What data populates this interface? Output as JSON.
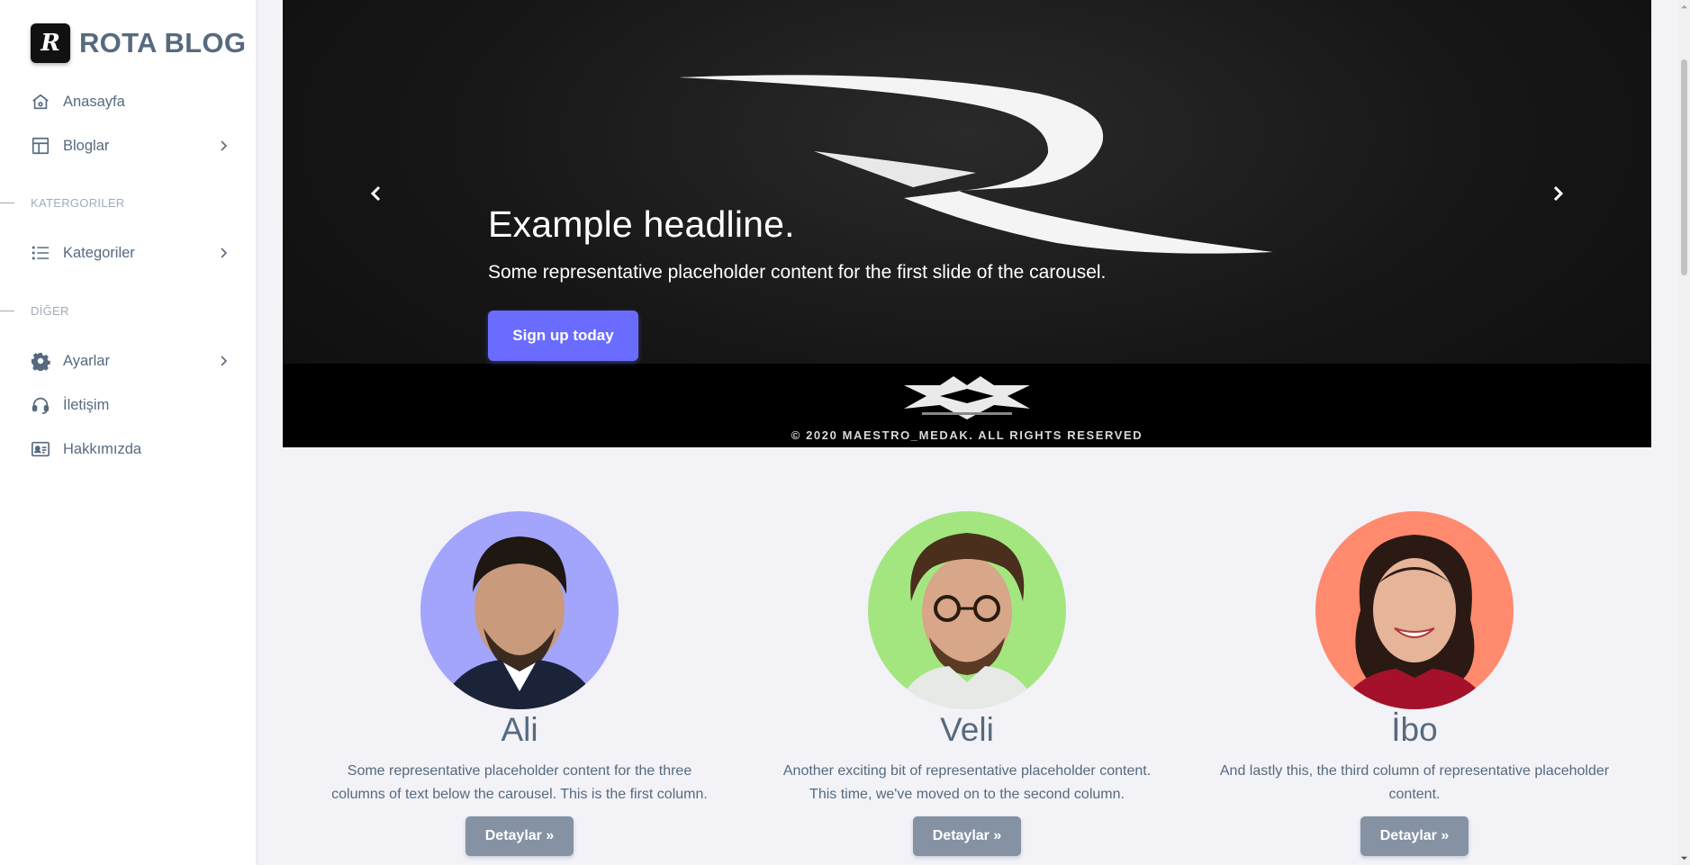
{
  "brand": {
    "name": "ROTA BLOG",
    "logo_letter": "R"
  },
  "sidebar": {
    "items": [
      {
        "label": "Anasayfa",
        "icon": "home-icon"
      },
      {
        "label": "Bloglar",
        "icon": "layout-icon",
        "has_submenu": true
      }
    ],
    "section_categories": {
      "header": "KATERGORILER",
      "items": [
        {
          "label": "Kategoriler",
          "icon": "list-icon",
          "has_submenu": true
        }
      ]
    },
    "section_other": {
      "header": "DİĞER",
      "items": [
        {
          "label": "Ayarlar",
          "icon": "gear-icon",
          "has_submenu": true
        },
        {
          "label": "İletişim",
          "icon": "headset-icon"
        },
        {
          "label": "Hakkımızda",
          "icon": "id-card-icon"
        }
      ]
    }
  },
  "carousel": {
    "headline": "Example headline.",
    "text": "Some representative placeholder content for the first slide of the carousel.",
    "cta": "Sign up today",
    "copyright": "© 2020 MAESTRO_MEDAK. ALL RIGHTS RESERVED"
  },
  "columns": [
    {
      "name": "Ali",
      "text": "Some representative placeholder content for the three columns of text below the carousel. This is the first column.",
      "button": "Detaylar »",
      "avatar_bg": "#a3a4fb"
    },
    {
      "name": "Veli",
      "text": "Another exciting bit of representative placeholder content. This time, we've moved on to the second column.",
      "button": "Detaylar »",
      "avatar_bg": "#a3e680"
    },
    {
      "name": "İbo",
      "text": "And lastly this, the third column of representative placeholder content.",
      "button": "Detaylar »",
      "avatar_bg": "#ff8a6e"
    }
  ],
  "colors": {
    "accent": "#696cff",
    "secondary": "#8592a3",
    "text": "#566a7f",
    "muted": "#a1acb8",
    "page_bg": "#f2f2f7"
  }
}
